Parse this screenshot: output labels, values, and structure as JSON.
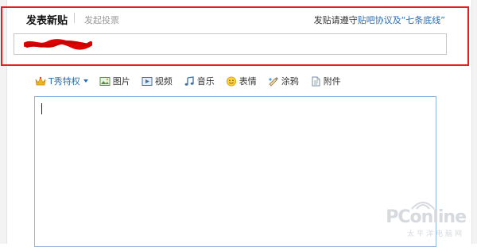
{
  "header": {
    "active_tab": "发表新贴",
    "inactive_tab": "发起投票",
    "rules_prefix": "发贴请遵守",
    "rules_link": "贴吧协议及“七条底线”"
  },
  "title_field": {
    "value": ""
  },
  "toolbar": {
    "items": [
      {
        "label": "T秀特权",
        "icon": "crown-icon",
        "has_dropdown": true
      },
      {
        "label": "图片",
        "icon": "image-icon"
      },
      {
        "label": "视频",
        "icon": "video-icon"
      },
      {
        "label": "音乐",
        "icon": "music-icon"
      },
      {
        "label": "表情",
        "icon": "smiley-icon"
      },
      {
        "label": "涂鸦",
        "icon": "paint-icon"
      },
      {
        "label": "附件",
        "icon": "attachment-icon"
      }
    ]
  },
  "watermark": {
    "brand": "PConline",
    "sub": "太平洋电脑网"
  },
  "colors": {
    "highlight": "#e61e1e",
    "link": "#2a6db5",
    "editor_border": "#8fb5e0"
  }
}
